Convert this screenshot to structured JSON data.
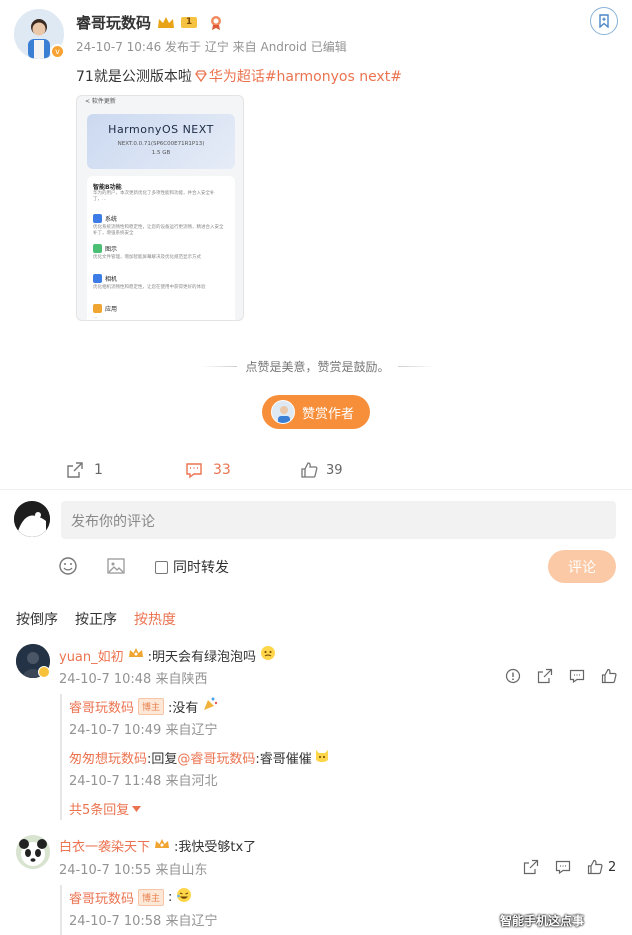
{
  "post": {
    "author": "睿哥玩数码",
    "vip_level": "1",
    "meta": "24-10-7 10:46 发布于 辽宁 来自 Android 已编辑",
    "text_plain": "71就是公测版本啦",
    "text_tag": "华为超话#harmonyos next#",
    "screenshot": {
      "top_bar": "< 软件更新",
      "os_name": "HarmonyOS NEXT",
      "version": "NEXT.0.0.71(SP6C00E71R1P13)",
      "size": "1.5 GB",
      "section_title": "智能B功能",
      "section_desc": "华为的用户，本次更新优化了多项性能和功能，并合入安全补丁，…",
      "items": [
        {
          "label": "系统",
          "desc": "优化系统流畅性和稳定性，让您的设备运行更流畅，精进合入安全补丁，增强系统安全"
        },
        {
          "label": "图示",
          "desc": "优化文件管理，增加智能屏幕解决及优化规范显示方式"
        },
        {
          "label": "相机",
          "desc": "优化相机流畅性和稳定性，让您在使用中获得更好的体验"
        },
        {
          "label": "应用",
          "desc": "…"
        }
      ]
    },
    "reward_hint": "点赞是美意，赞赏是鼓励。",
    "reward_button": "赞赏作者",
    "actions": {
      "share": "1",
      "comment": "33",
      "like": "39"
    }
  },
  "composer": {
    "placeholder": "发布你的评论",
    "repost_label": "同时转发",
    "submit_label": "评论"
  },
  "sort_tabs": [
    "按倒序",
    "按正序",
    "按热度"
  ],
  "comments": [
    {
      "user": "yuan_如初",
      "text": ":明天会有绿泡泡吗",
      "meta": "24-10-7 10:48 来自陕西",
      "replies": [
        {
          "user": "睿哥玩数码",
          "badge": "博主",
          "text": ":没有",
          "meta": "24-10-7 10:49 来自辽宁"
        },
        {
          "user": "匆匆想玩数码",
          "text_pre": ":回复",
          "mention": "@睿哥玩数码",
          "text": ":睿哥催催",
          "meta": "24-10-7 11:48 来自河北"
        }
      ],
      "more_replies": "共5条回复"
    },
    {
      "user": "白衣一袭染天下",
      "text": ":我快受够tx了",
      "meta": "24-10-7 10:55 来自山东",
      "like_count": "2",
      "replies": [
        {
          "user": "睿哥玩数码",
          "badge": "博主",
          "text": ":",
          "meta": "24-10-7 10:58 来自辽宁"
        }
      ]
    }
  ],
  "watermark": "智能手机这点事",
  "colors": {
    "accent": "#eb7350",
    "submit_bg": "#fbc9a5",
    "reward_bg": "#f78e3a",
    "tag": "#eb7350"
  }
}
